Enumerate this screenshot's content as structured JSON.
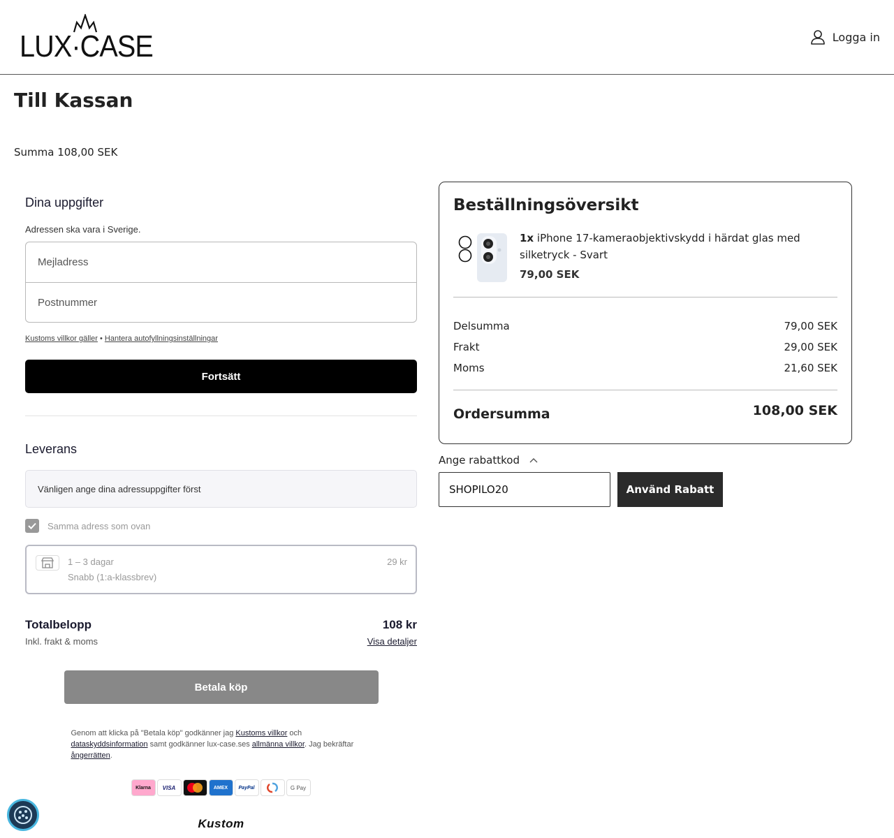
{
  "header": {
    "logo_text": "LUX·CASE",
    "login_label": "Logga in"
  },
  "page": {
    "title": "Till Kassan",
    "sum_line": "Summa 108,00 SEK"
  },
  "checkout": {
    "details_title": "Dina uppgifter",
    "address_note": "Adressen ska vara i Sverige.",
    "email_placeholder": "Mejladress",
    "postcode_placeholder": "Postnummer",
    "link_terms": "Kustoms villkor gäller",
    "link_separator": " • ",
    "link_autofill": "Hantera autofyllningsinställningar",
    "continue_label": "Fortsätt",
    "delivery_title": "Leverans",
    "delivery_info": "Vänligen ange dina adressuppgifter först",
    "same_address_label": "Samma adress som ovan",
    "shipping_days": "1 – 3 dagar",
    "shipping_method": "Snabb (1:a-klassbrev)",
    "shipping_price": "29 kr",
    "total_label": "Totalbelopp",
    "total_amount": "108 kr",
    "total_sub": "Inkl. frakt & moms",
    "show_details": "Visa detaljer",
    "pay_label": "Betala köp",
    "terms_1": "Genom att klicka på \"Betala köp\" godkänner jag ",
    "terms_link_1": "Kustoms villkor",
    "terms_2": " och ",
    "terms_link_2": "dataskyddsinformation",
    "terms_3": " samt godkänner lux-case.ses ",
    "terms_link_3": "allmänna villkor",
    "terms_4": ". Jag bekräftar ",
    "terms_link_4": "ångerrätten",
    "terms_5": ".",
    "payment_methods": [
      "Klarna",
      "VISA",
      "Mastercard",
      "AMEX",
      "PayPal",
      "Swish",
      "G Pay"
    ],
    "brand": "Kustom"
  },
  "overview": {
    "title": "Beställningsöversikt",
    "item_qty": "1x",
    "item_name": "iPhone 17-kameraobjektivskydd i härdat glas med silketryck - Svart",
    "item_price": "79,00 SEK",
    "rows": [
      {
        "label": "Delsumma",
        "value": "79,00 SEK"
      },
      {
        "label": "Frakt",
        "value": "29,00 SEK"
      },
      {
        "label": "Moms",
        "value": "21,60 SEK"
      }
    ],
    "total_label": "Ordersumma",
    "total_value": "108,00 SEK"
  },
  "discount": {
    "label": "Ange rabattkod",
    "code_value": "SHOPILO20",
    "apply_label": "Använd Rabatt"
  },
  "colors": {
    "primary_button": "#000000",
    "pay_button_disabled": "#888888",
    "apply_button": "#2b2b2b",
    "cookie_accent": "#49b7e0"
  }
}
